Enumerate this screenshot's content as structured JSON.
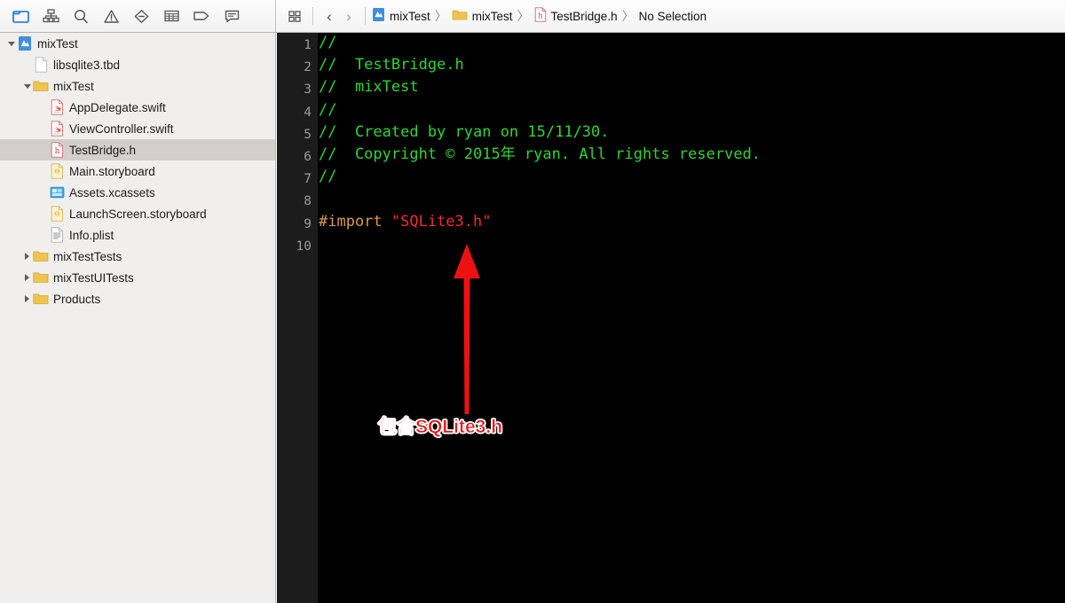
{
  "navigator_toolbar": {
    "icons": [
      {
        "name": "folder-icon",
        "label": "Project navigator",
        "active": true
      },
      {
        "name": "hierarchy-icon",
        "label": "Symbol navigator",
        "active": false
      },
      {
        "name": "search-icon",
        "label": "Find navigator",
        "active": false
      },
      {
        "name": "warning-triangle-icon",
        "label": "Issue navigator",
        "active": false
      },
      {
        "name": "diamond-minus-icon",
        "label": "Test navigator",
        "active": false
      },
      {
        "name": "table-grid-icon",
        "label": "Debug navigator",
        "active": false
      },
      {
        "name": "tag-icon",
        "label": "Breakpoint navigator",
        "active": false
      },
      {
        "name": "speech-bubble-icon",
        "label": "Report navigator",
        "active": false
      }
    ]
  },
  "jumpbar": {
    "grid_icon": "related-items-icon",
    "back_label": "‹",
    "forward_label": "›",
    "separator": "〉",
    "crumbs": [
      {
        "label": "mixTest",
        "icon": "xcode-project-icon"
      },
      {
        "label": "mixTest",
        "icon": "folder-icon"
      },
      {
        "label": "TestBridge.h",
        "icon": "header-file-icon"
      },
      {
        "label": "No Selection",
        "icon": "none"
      }
    ]
  },
  "sidebar": {
    "rows": [
      {
        "label": "mixTest",
        "icon": "xcode-project-icon",
        "indent": 0,
        "disclosure": "open",
        "selected": false
      },
      {
        "label": "libsqlite3.tbd",
        "icon": "blank-document-icon",
        "indent": 1,
        "disclosure": "none",
        "selected": false
      },
      {
        "label": "mixTest",
        "icon": "folder-icon",
        "indent": 1,
        "disclosure": "open",
        "selected": false
      },
      {
        "label": "AppDelegate.swift",
        "icon": "swift-file-icon",
        "indent": 2,
        "disclosure": "none",
        "selected": false
      },
      {
        "label": "ViewController.swift",
        "icon": "swift-file-icon",
        "indent": 2,
        "disclosure": "none",
        "selected": false
      },
      {
        "label": "TestBridge.h",
        "icon": "header-file-icon",
        "indent": 2,
        "disclosure": "none",
        "selected": true
      },
      {
        "label": "Main.storyboard",
        "icon": "storyboard-file-icon",
        "indent": 2,
        "disclosure": "none",
        "selected": false
      },
      {
        "label": "Assets.xcassets",
        "icon": "assets-catalog-icon",
        "indent": 2,
        "disclosure": "none",
        "selected": false
      },
      {
        "label": "LaunchScreen.storyboard",
        "icon": "storyboard-file-icon",
        "indent": 2,
        "disclosure": "none",
        "selected": false
      },
      {
        "label": "Info.plist",
        "icon": "plist-file-icon",
        "indent": 2,
        "disclosure": "none",
        "selected": false
      },
      {
        "label": "mixTestTests",
        "icon": "folder-icon",
        "indent": 1,
        "disclosure": "closed",
        "selected": false
      },
      {
        "label": "mixTestUITests",
        "icon": "folder-icon",
        "indent": 1,
        "disclosure": "closed",
        "selected": false
      },
      {
        "label": "Products",
        "icon": "folder-icon",
        "indent": 1,
        "disclosure": "closed",
        "selected": false
      }
    ]
  },
  "editor": {
    "line_numbers": [
      "1",
      "2",
      "3",
      "4",
      "5",
      "6",
      "7",
      "8",
      "9",
      "10"
    ],
    "lines": [
      {
        "n": 1,
        "tokens": [
          {
            "t": "//",
            "k": "comment"
          }
        ]
      },
      {
        "n": 2,
        "tokens": [
          {
            "t": "//  TestBridge.h",
            "k": "comment"
          }
        ]
      },
      {
        "n": 3,
        "tokens": [
          {
            "t": "//  mixTest",
            "k": "comment"
          }
        ]
      },
      {
        "n": 4,
        "tokens": [
          {
            "t": "//",
            "k": "comment"
          }
        ]
      },
      {
        "n": 5,
        "tokens": [
          {
            "t": "//  Created by ryan on 15/11/30.",
            "k": "comment"
          }
        ]
      },
      {
        "n": 6,
        "tokens": [
          {
            "t": "//  Copyright © 2015年 ryan. All rights reserved.",
            "k": "comment"
          }
        ]
      },
      {
        "n": 7,
        "tokens": [
          {
            "t": "//",
            "k": "comment"
          }
        ]
      },
      {
        "n": 8,
        "tokens": []
      },
      {
        "n": 9,
        "tokens": [
          {
            "t": "#import ",
            "k": "preprocessor"
          },
          {
            "t": "\"SQLite3.h\"",
            "k": "string"
          }
        ]
      },
      {
        "n": 10,
        "tokens": []
      }
    ]
  },
  "annotation": {
    "arrow_name": "red-up-arrow",
    "arrow_color": "#ee1111",
    "text": "包含SQLite3.h",
    "text_color": "#ee0d12",
    "outline_color": "#ffffff"
  },
  "colors": {
    "editor_background": "#000000",
    "gutter_background": "#1c1c1c",
    "comment_green": "#2fd435",
    "preprocessor_orange": "#d99a4e",
    "string_red": "#ec2d33",
    "sidebar_background": "#f0efed",
    "selection_gray": "#d3cfcb"
  }
}
